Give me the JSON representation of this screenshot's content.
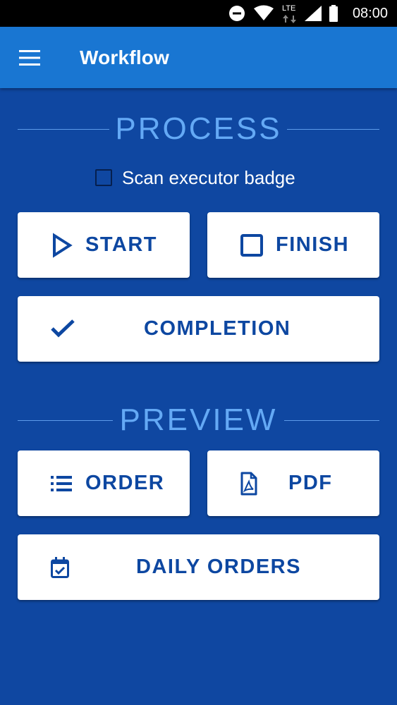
{
  "status_bar": {
    "network": "LTE",
    "time": "08:00"
  },
  "app_bar": {
    "title": "Workflow"
  },
  "process": {
    "heading": "PROCESS",
    "scan_checkbox": {
      "label": "Scan executor badge",
      "checked": false
    },
    "start_label": "START",
    "finish_label": "FINISH",
    "completion_label": "COMPLETION"
  },
  "preview": {
    "heading": "PREVIEW",
    "order_label": "ORDER",
    "pdf_label": "PDF",
    "daily_orders_label": "DAILY ORDERS"
  },
  "colors": {
    "background": "#0f47a1",
    "app_bar": "#1976d2",
    "heading": "#64a9f5",
    "button_text": "#0d47a1"
  },
  "icons": {
    "menu": "hamburger-menu-icon",
    "start": "play-outline-icon",
    "finish": "square-outline-icon",
    "completion": "check-icon",
    "order": "list-icon",
    "pdf": "pdf-file-icon",
    "daily_orders": "calendar-check-icon"
  }
}
